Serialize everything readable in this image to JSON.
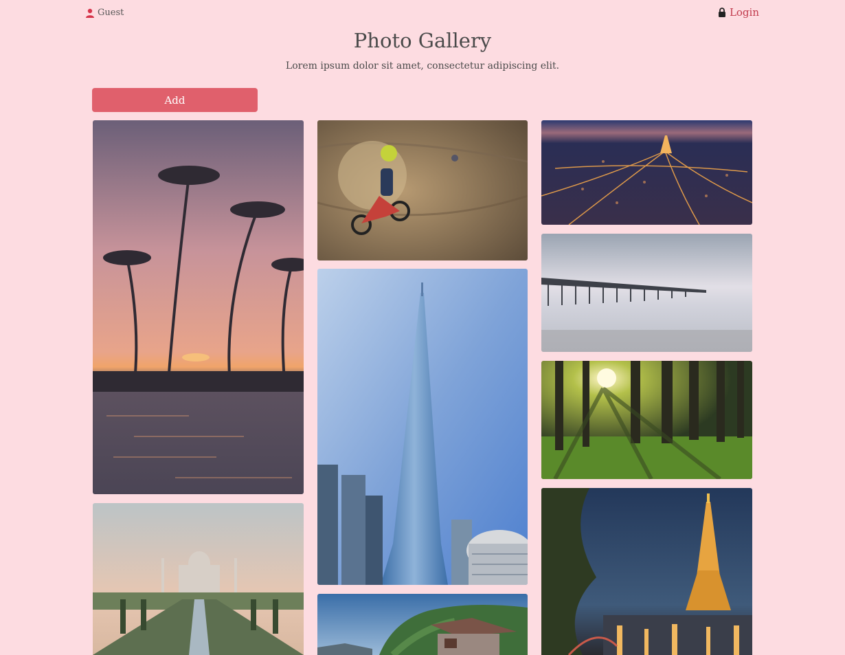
{
  "header": {
    "user_label": "Guest",
    "login_label": "Login",
    "title": "Photo Gallery",
    "subtitle": "Lorem ipsum dolor sit amet, consectetur adipiscing elit."
  },
  "toolbar": {
    "add_label": "Add"
  },
  "colors": {
    "background": "#fddce1",
    "accent": "#e0606c",
    "login": "#c0394b"
  },
  "icons": {
    "user": "user-icon",
    "login": "lock-icon"
  },
  "gallery": [
    {
      "subject": "tropical palm sunset pool"
    },
    {
      "subject": "taj mahal"
    },
    {
      "subject": "motocross rider"
    },
    {
      "subject": "burj khalifa skyscraper"
    },
    {
      "subject": "mountain cabin"
    },
    {
      "subject": "paris city night aerial"
    },
    {
      "subject": "pier over misty sea"
    },
    {
      "subject": "sunlit forest"
    },
    {
      "subject": "eiffel tower at night"
    }
  ]
}
